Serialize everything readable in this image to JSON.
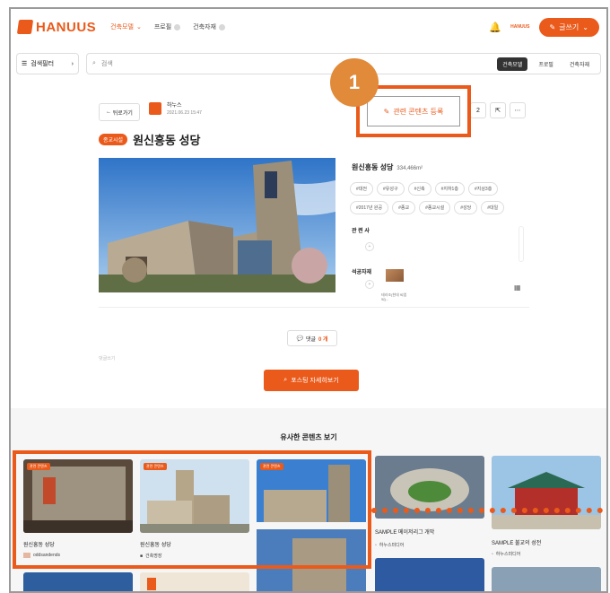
{
  "nav": {
    "logo": "HANUUS",
    "links": [
      "건축모델",
      "프로필",
      "건축자재"
    ],
    "write_label": "글쓰기",
    "mini_logo": "HANUUS"
  },
  "search": {
    "filter_label": "검색필터",
    "placeholder": "검색",
    "tabs": [
      "건축모델",
      "프로필",
      "건축자재"
    ]
  },
  "post": {
    "back_label": "뒤로가기",
    "author_name": "하누스",
    "author_date": "2021.06.23 15:47",
    "register_label": "관련 콘텐츠 등록",
    "action_count": "2",
    "category": "종교시설",
    "title": "원신흥동 성당",
    "info_name": "원신흥동 성당",
    "info_area": "334,466m²",
    "tags": [
      "#대전",
      "#유성구",
      "#신축",
      "#지하1층",
      "#지상3층",
      "#2017년 완공",
      "#종교",
      "#종교시설",
      "#성당",
      "#대일"
    ],
    "arch_label": "관 련 사",
    "mat_label": "석공자재",
    "mat_item": "테라조(현대 씨엠씨)...",
    "comment_label": "댓글",
    "comment_count": "0 개",
    "reply_faint": "댓글쓰기",
    "detail_label": "포스팅 자세히보기"
  },
  "annotation": {
    "number": "1"
  },
  "similar": {
    "title": "유사한 콘텐츠 보기",
    "cards": [
      {
        "tag": "관련 콘텐츠",
        "name": "원신흥동 성당",
        "user": "oddsandends"
      },
      {
        "tag": "관련 콘텐츠",
        "name": "원신흥동 성당",
        "user": "건축명장"
      },
      {
        "tag": "관련 콘텐츠",
        "name": "",
        "user": ""
      },
      {
        "tag": "",
        "name": "SAMPLE 메이저리그 개막",
        "user": "하누스미디어"
      },
      {
        "tag": "",
        "name": "SAMPLE 불교의 성전",
        "user": "하누스미디어"
      }
    ]
  },
  "colors": {
    "accent": "#ea5a1b",
    "callout_circle": "#e08a3a"
  }
}
